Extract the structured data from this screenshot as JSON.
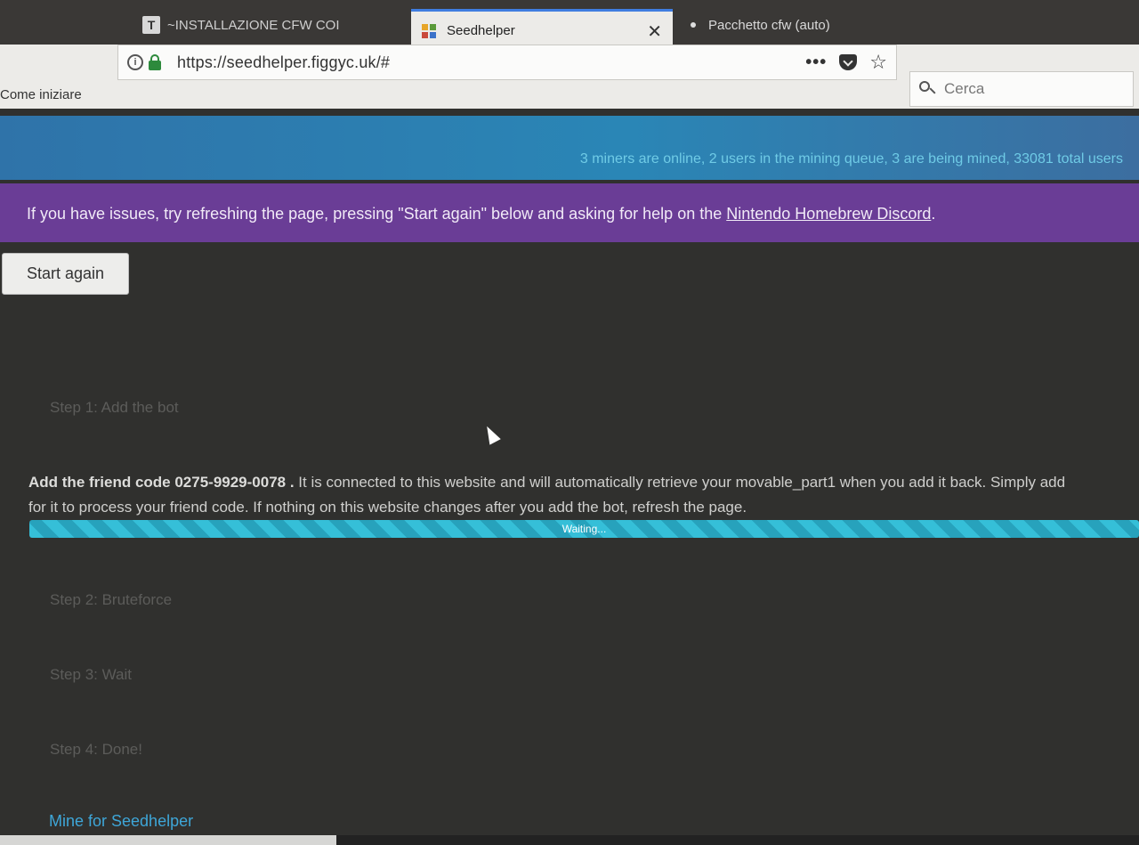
{
  "tabs": [
    {
      "label": "~INSTALLAZIONE CFW COI",
      "icon": "t-favicon-icon"
    },
    {
      "label": "Seedhelper",
      "icon": "seedhelper-favicon-icon",
      "active": true
    },
    {
      "label": "Pacchetto cfw (auto)",
      "icon": "dot-favicon-icon"
    }
  ],
  "navbar": {
    "url": "https://seedhelper.figgyc.uk/#",
    "search_placeholder": "Cerca",
    "bookmark": "Come iniziare"
  },
  "page": {
    "stats": "3 miners are online, 2 users in the mining queue, 3 are being mined, 33081 total users",
    "alert_prefix": "If you have issues, try refreshing the page, pressing \"Start again\" below and asking for help on the ",
    "alert_link": "Nintendo Homebrew Discord",
    "alert_suffix": ".",
    "start_again": "Start again",
    "steps": [
      "Step 1: Add the bot",
      "Step 2: Bruteforce",
      "Step 3: Wait",
      "Step 4: Done!"
    ],
    "step1": {
      "lead": "Add the friend code 0275-9929-0078 .",
      "line1": " It is connected to this website and will automatically retrieve your movable_part1 when you add it back. Simply add",
      "line2": "for it to process your friend code. If nothing on this website changes after you add the bot, refresh the page.",
      "progress_label": "Waiting...",
      "progress": 1.0
    },
    "footer_link": "Mine for Seedhelper"
  },
  "colors": {
    "stats_bar": "#2a86b6",
    "alert_bar": "#6a3d96",
    "progress": "#2aa9c4",
    "link": "#3ea6d8"
  }
}
